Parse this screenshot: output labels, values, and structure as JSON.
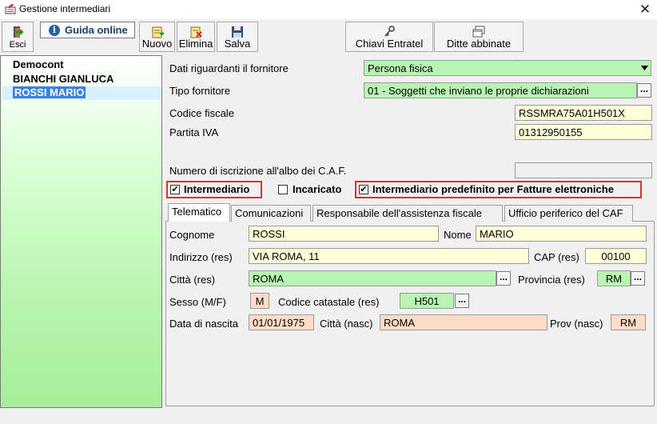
{
  "window": {
    "title": "Gestione intermediari",
    "close_glyph": "✕"
  },
  "toolbar": {
    "esci": "Esci",
    "guida": "Guida online",
    "nuovo": "Nuovo",
    "elimina": "Elimina",
    "salva": "Salva",
    "chiavi": "Chiavi Entratel",
    "ditte": "Ditte abbinate"
  },
  "list": {
    "items": [
      "Democont",
      "BIANCHI GIANLUCA",
      "ROSSI MARIO"
    ],
    "selected_index": 2
  },
  "form": {
    "dati_label": "Dati riguardanti il fornitore",
    "dati_value": "Persona fisica",
    "tipo_label": "Tipo fornitore",
    "tipo_value": "01 - Soggetti che inviano le proprie dichiarazioni",
    "cf_label": "Codice fiscale",
    "cf_value": "RSSMRA75A01H501X",
    "piva_label": "Partita IVA",
    "piva_value": "01312950155",
    "caf_label": "Numero di iscrizione all'albo dei C.A.F.",
    "caf_value": "",
    "intermediario_label": "Intermediario",
    "incaricato_label": "Incaricato",
    "predefinito_label": "Intermediario predefinito per Fatture elettroniche",
    "check_glyph": "✔",
    "dots": "..."
  },
  "tabs": [
    {
      "label": "Telematico",
      "active": true
    },
    {
      "label": "Comunicazioni",
      "active": false
    },
    {
      "label": "Responsabile dell'assistenza fiscale",
      "active": false
    },
    {
      "label": "Ufficio periferico del CAF",
      "active": false
    }
  ],
  "telematico": {
    "cognome_label": "Cognome",
    "cognome": "ROSSI",
    "nome_label": "Nome",
    "nome": "MARIO",
    "indirizzo_label": "Indirizzo (res)",
    "indirizzo": "VIA ROMA, 11",
    "cap_label": "CAP (res)",
    "cap": "00100",
    "citta_label": "Città (res)",
    "citta": "ROMA",
    "provincia_label": "Provincia (res)",
    "provincia": "RM",
    "sesso_label": "Sesso (M/F)",
    "sesso": "M",
    "catastale_label": "Codice catastale (res)",
    "catastale": "H501",
    "nascita_label": "Data di nascita",
    "nascita": "01/01/1975",
    "citta_nasc_label": "Città (nasc)",
    "citta_nasc": "ROMA",
    "prov_nasc_label": "Prov (nasc)",
    "prov_nasc": "RM"
  },
  "colors": {
    "green_field": "#b9f5b2",
    "yellow_field": "#ffffd9",
    "salmon_field": "#ffdcc8",
    "highlight_red": "#d9332b",
    "selection_blue": "#3b82d8"
  }
}
